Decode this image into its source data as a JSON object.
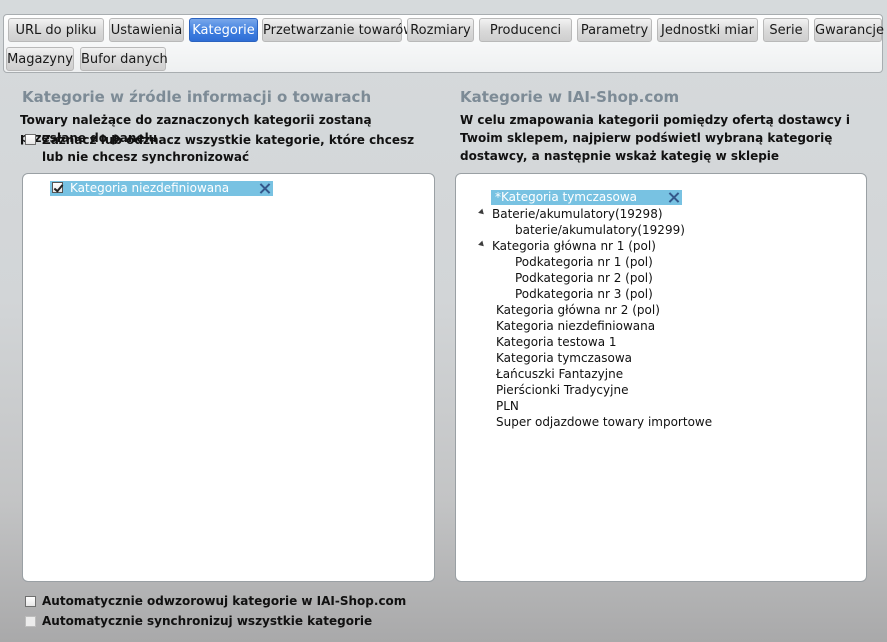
{
  "tabs": [
    "URL do pliku",
    "Ustawienia",
    "Kategorie",
    "Przetwarzanie towarów",
    "Rozmiary",
    "Producenci",
    "Parametry",
    "Jednostki miar",
    "Serie",
    "Gwarancje",
    "Magazyny",
    "Bufor danych"
  ],
  "active_tab": "Kategorie",
  "left": {
    "title": "Kategorie w źródle informacji o towarach",
    "description": "Towary należące do zaznaczonych kategorii zostaną przesłane do panelu",
    "select_all_label": "Zaznacz lub odznacz wszystkie kategorie, które chcesz lub nie chcesz synchronizować",
    "items": [
      {
        "label": "Kategoria niezdefiniowana",
        "checked": true
      }
    ]
  },
  "right": {
    "title": "Kategorie w IAI-Shop.com",
    "description": "W celu zmapowania kategorii pomiędzy ofertą dostawcy i Twoim sklepem, najpierw podświetl wybraną kategorię dostawcy, a następnie wskaż kategię w sklepie",
    "selected": "*Kategoria tymczasowa",
    "tree": [
      {
        "label": "Baterie/akumulatory(19298)",
        "expanded": true,
        "children": [
          "baterie/akumulatory(19299)"
        ]
      },
      {
        "label": "Kategoria główna nr 1 (pol)",
        "expanded": true,
        "children": [
          "Podkategoria nr 1 (pol)",
          "Podkategoria nr 2 (pol)",
          "Podkategoria nr 3 (pol)"
        ]
      },
      {
        "label": "Kategoria główna nr 2 (pol)"
      },
      {
        "label": "Kategoria niezdefiniowana"
      },
      {
        "label": "Kategoria testowa 1"
      },
      {
        "label": "Kategoria tymczasowa"
      },
      {
        "label": "Łańcuszki Fantazyjne"
      },
      {
        "label": "Pierścionki Tradycyjne"
      },
      {
        "label": "PLN"
      },
      {
        "label": "Super odjazdowe towary importowe"
      }
    ]
  },
  "footer": {
    "auto_map_label": "Automatycznie odwzorowuj kategorie w IAI-Shop.com",
    "auto_map_checked": false,
    "auto_sync_label": "Automatycznie synchronizuj wszystkie kategorie",
    "auto_sync_checked": false,
    "auto_sync_enabled": false
  },
  "icons": {
    "remove": "close-icon",
    "expand": "expanded-triangle-icon",
    "check": "checkbox-icon"
  },
  "colors": {
    "active_tab": "#3f7fe0",
    "selection": "#78c2e2",
    "section_title": "#7d8b96"
  }
}
